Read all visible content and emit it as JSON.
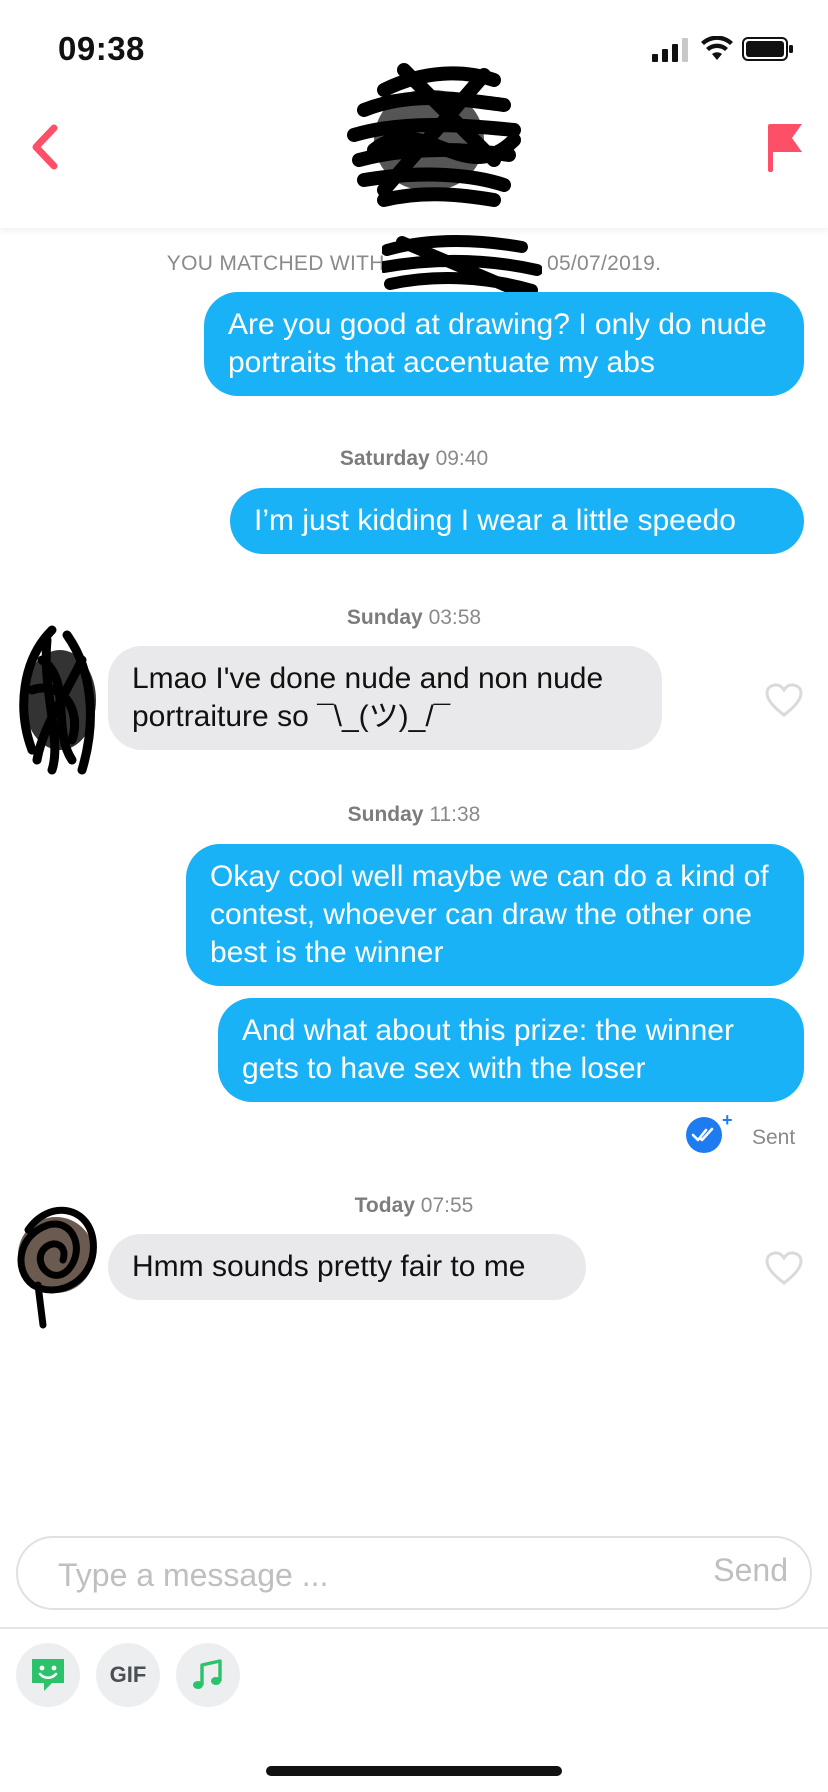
{
  "status_bar": {
    "time": "09:38"
  },
  "match_line": {
    "prefix": "YOU MATCHED WITH",
    "date": "05/07/2019."
  },
  "messages": [
    {
      "type": "out",
      "text": "Are you good at drawing? I only do nude portraits that accentuate my abs"
    },
    {
      "type": "day",
      "day": "Saturday",
      "time": "09:40"
    },
    {
      "type": "out",
      "text": "I’m just kidding I wear a little speedo"
    },
    {
      "type": "day",
      "day": "Sunday",
      "time": "03:58"
    },
    {
      "type": "in",
      "text": "Lmao I've done nude and non nude portraiture so ¯\\_(ツ)_/¯"
    },
    {
      "type": "day",
      "day": "Sunday",
      "time": "11:38"
    },
    {
      "type": "out",
      "text": "Okay cool well maybe we can do a kind of contest, whoever can draw the other one best is the winner"
    },
    {
      "type": "out",
      "text": "And what about this prize: the winner gets to have sex with the loser"
    },
    {
      "type": "day",
      "day": "Today",
      "time": "07:55"
    },
    {
      "type": "in",
      "text": "Hmm sounds pretty fair to me"
    }
  ],
  "receipt": {
    "status": "Sent",
    "plus": "+"
  },
  "composer": {
    "placeholder": "Type a message ...",
    "send_label": "Send"
  },
  "toolbar": {
    "gif_label": "GIF"
  },
  "colors": {
    "accent": "#fd5068",
    "bubble_out": "#1ab2f7",
    "bubble_in": "#e9e9eb",
    "sticker": "#2bc26b"
  },
  "icons": [
    "back-chevron-icon",
    "flag-icon",
    "heart-icon",
    "double-check-icon",
    "sticker-icon",
    "music-note-icon"
  ]
}
